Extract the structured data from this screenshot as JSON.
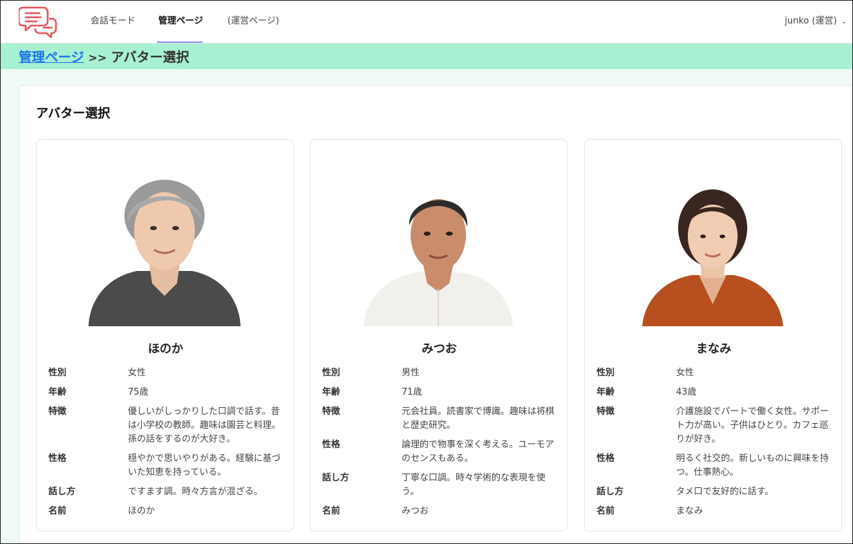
{
  "nav": {
    "items": [
      {
        "label": "会話モード"
      },
      {
        "label": "管理ページ"
      },
      {
        "label": "(運営ページ)"
      }
    ],
    "user_label": "junko (運営)",
    "accent": "#8b8ff0"
  },
  "breadcrumb": {
    "link": "管理ページ",
    "separator": ">>",
    "current": "アバター選択"
  },
  "page": {
    "title": "アバター選択"
  },
  "labels": {
    "gender": "性別",
    "age": "年齢",
    "traits": "特徴",
    "personality": "性格",
    "speech": "話し方",
    "name": "名前"
  },
  "avatars": [
    {
      "name": "ほのか",
      "gender": "女性",
      "age": "75歳",
      "traits": "優しいがしっかりした口調で話す。昔は小学校の教師。趣味は園芸と料理。孫の話をするのが大好き。",
      "personality": "穏やかで思いやりがある。経験に基づいた知恵を持っている。",
      "speech": "ですます調。時々方言が混ざる。",
      "name_value": "ほのか"
    },
    {
      "name": "みつお",
      "gender": "男性",
      "age": "71歳",
      "traits": "元会社員。読書家で博識。趣味は将棋と歴史研究。",
      "personality": "論理的で物事を深く考える。ユーモアのセンスもある。",
      "speech": "丁寧な口調。時々学術的な表現を使う。",
      "name_value": "みつお"
    },
    {
      "name": "まなみ",
      "gender": "女性",
      "age": "43歳",
      "traits": "介護施設でパートで働く女性。サポート力が高い。子供はひとり。カフェ巡りが好き。",
      "personality": "明るく社交的。新しいものに興味を持つ。仕事熱心。",
      "speech": "タメ口で友好的に話す。",
      "name_value": "まなみ"
    }
  ],
  "colors": {
    "crumb_bar": "#a8f0d2",
    "link": "#1a73e8",
    "logo": "#e9555d"
  }
}
